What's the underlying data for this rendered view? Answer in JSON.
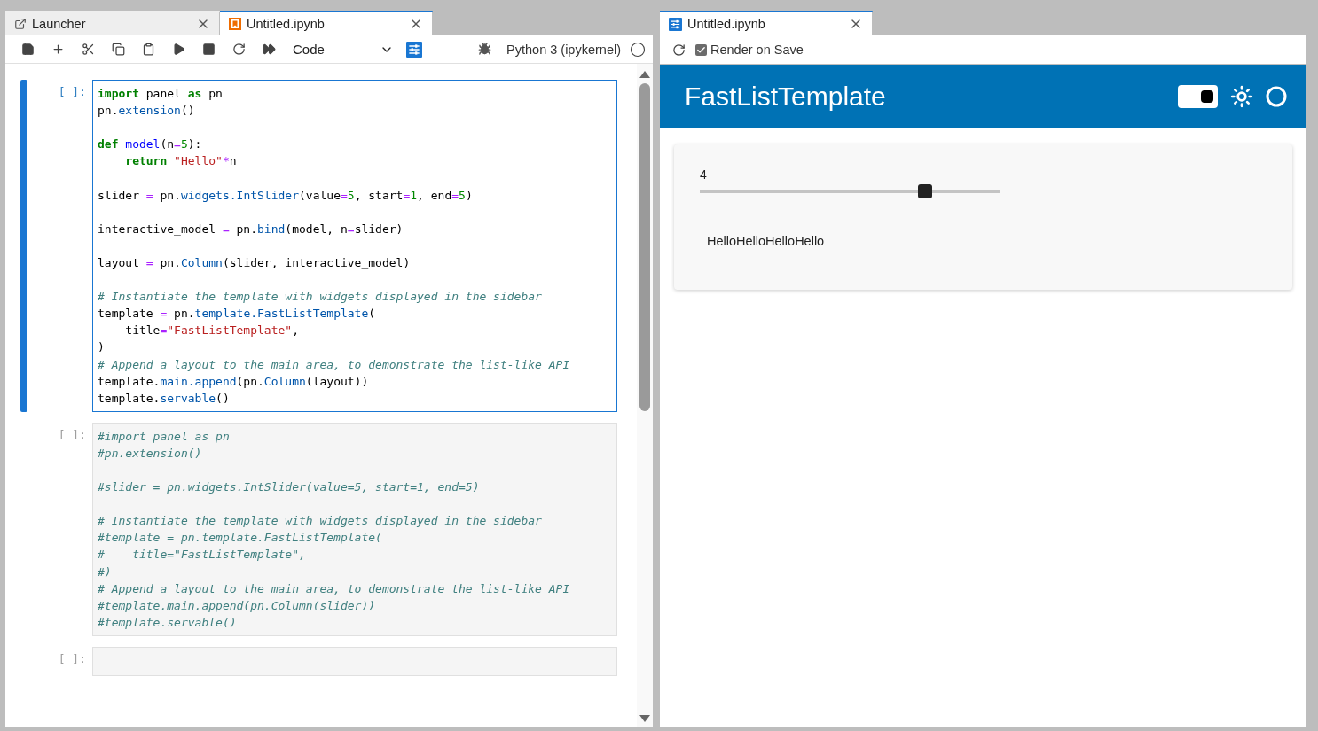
{
  "notebook_panel": {
    "tabs": [
      {
        "kind": "launcher",
        "label": "Launcher",
        "selected": false
      },
      {
        "kind": "notebook",
        "label": "Untitled.ipynb",
        "selected": true
      }
    ],
    "toolbar": {
      "cell_type": "Code",
      "kernel": "Python 3 (ipykernel)"
    },
    "cells": [
      {
        "prompt": "[ ]:",
        "selected": true,
        "lines": [
          {
            "kind": "code",
            "tokens": [
              {
                "kind": "keyword",
                "text": "import"
              },
              {
                "kind": "plain",
                "text": " panel "
              },
              {
                "kind": "keyword",
                "text": "as"
              },
              {
                "kind": "plain",
                "text": " pn"
              }
            ]
          },
          {
            "kind": "code",
            "tokens": [
              {
                "kind": "plain",
                "text": "pn."
              },
              {
                "kind": "property",
                "text": "extension"
              },
              {
                "kind": "plain",
                "text": "()"
              }
            ]
          },
          {
            "kind": "blank"
          },
          {
            "kind": "code",
            "tokens": [
              {
                "kind": "keyword",
                "text": "def"
              },
              {
                "kind": "def",
                "text": " model"
              },
              {
                "kind": "plain",
                "text": "(n"
              },
              {
                "kind": "op",
                "text": "="
              },
              {
                "kind": "number",
                "text": "5"
              },
              {
                "kind": "plain",
                "text": "):"
              }
            ]
          },
          {
            "kind": "code",
            "tokens": [
              {
                "kind": "keyword",
                "text": "    return"
              },
              {
                "kind": "string",
                "text": " \"Hello\""
              },
              {
                "kind": "op",
                "text": "*"
              },
              {
                "kind": "plain",
                "text": "n"
              }
            ]
          },
          {
            "kind": "blank"
          },
          {
            "kind": "code",
            "tokens": [
              {
                "kind": "plain",
                "text": "slider "
              },
              {
                "kind": "op",
                "text": "="
              },
              {
                "kind": "plain",
                "text": " pn."
              },
              {
                "kind": "property",
                "text": "widgets.IntSlider"
              },
              {
                "kind": "plain",
                "text": "(value"
              },
              {
                "kind": "op",
                "text": "="
              },
              {
                "kind": "number",
                "text": "5"
              },
              {
                "kind": "plain",
                "text": ", start"
              },
              {
                "kind": "op",
                "text": "="
              },
              {
                "kind": "number",
                "text": "1"
              },
              {
                "kind": "plain",
                "text": ", end"
              },
              {
                "kind": "op",
                "text": "="
              },
              {
                "kind": "number",
                "text": "5"
              },
              {
                "kind": "plain",
                "text": ")"
              }
            ]
          },
          {
            "kind": "blank"
          },
          {
            "kind": "code",
            "tokens": [
              {
                "kind": "plain",
                "text": "interactive_model "
              },
              {
                "kind": "op",
                "text": "="
              },
              {
                "kind": "plain",
                "text": " pn."
              },
              {
                "kind": "property",
                "text": "bind"
              },
              {
                "kind": "plain",
                "text": "(model, n"
              },
              {
                "kind": "op",
                "text": "="
              },
              {
                "kind": "plain",
                "text": "slider)"
              }
            ]
          },
          {
            "kind": "blank"
          },
          {
            "kind": "code",
            "tokens": [
              {
                "kind": "plain",
                "text": "layout "
              },
              {
                "kind": "op",
                "text": "="
              },
              {
                "kind": "plain",
                "text": " pn."
              },
              {
                "kind": "property",
                "text": "Column"
              },
              {
                "kind": "plain",
                "text": "(slider, interactive_model)"
              }
            ]
          },
          {
            "kind": "blank"
          },
          {
            "kind": "code",
            "tokens": [
              {
                "kind": "comment",
                "text": "# Instantiate the template with widgets displayed in the sidebar"
              }
            ]
          },
          {
            "kind": "code",
            "tokens": [
              {
                "kind": "plain",
                "text": "template "
              },
              {
                "kind": "op",
                "text": "="
              },
              {
                "kind": "plain",
                "text": " pn."
              },
              {
                "kind": "property",
                "text": "template.FastListTemplate"
              },
              {
                "kind": "plain",
                "text": "("
              }
            ]
          },
          {
            "kind": "code",
            "tokens": [
              {
                "kind": "plain",
                "text": "    title"
              },
              {
                "kind": "op",
                "text": "="
              },
              {
                "kind": "string",
                "text": "\"FastListTemplate\""
              },
              {
                "kind": "plain",
                "text": ","
              }
            ]
          },
          {
            "kind": "code",
            "tokens": [
              {
                "kind": "plain",
                "text": ")"
              }
            ]
          },
          {
            "kind": "code",
            "tokens": [
              {
                "kind": "comment",
                "text": "# Append a layout to the main area, to demonstrate the list-like API"
              }
            ]
          },
          {
            "kind": "code",
            "tokens": [
              {
                "kind": "plain",
                "text": "template."
              },
              {
                "kind": "property",
                "text": "main.append"
              },
              {
                "kind": "plain",
                "text": "(pn."
              },
              {
                "kind": "property",
                "text": "Column"
              },
              {
                "kind": "plain",
                "text": "(layout))"
              }
            ]
          },
          {
            "kind": "code",
            "tokens": [
              {
                "kind": "plain",
                "text": "template."
              },
              {
                "kind": "property",
                "text": "servable"
              },
              {
                "kind": "plain",
                "text": "()"
              }
            ]
          }
        ]
      },
      {
        "prompt": "[ ]:",
        "selected": false,
        "lines": [
          {
            "kind": "code",
            "tokens": [
              {
                "kind": "comment",
                "text": "#import panel as pn"
              }
            ]
          },
          {
            "kind": "code",
            "tokens": [
              {
                "kind": "comment",
                "text": "#pn.extension()"
              }
            ]
          },
          {
            "kind": "blank"
          },
          {
            "kind": "code",
            "tokens": [
              {
                "kind": "comment",
                "text": "#slider = pn.widgets.IntSlider(value=5, start=1, end=5)"
              }
            ]
          },
          {
            "kind": "blank"
          },
          {
            "kind": "code",
            "tokens": [
              {
                "kind": "comment",
                "text": "# Instantiate the template with widgets displayed in the sidebar"
              }
            ]
          },
          {
            "kind": "code",
            "tokens": [
              {
                "kind": "comment",
                "text": "#template = pn.template.FastListTemplate("
              }
            ]
          },
          {
            "kind": "code",
            "tokens": [
              {
                "kind": "comment",
                "text": "#    title=\"FastListTemplate\","
              }
            ]
          },
          {
            "kind": "code",
            "tokens": [
              {
                "kind": "comment",
                "text": "#)"
              }
            ]
          },
          {
            "kind": "code",
            "tokens": [
              {
                "kind": "comment",
                "text": "# Append a layout to the main area, to demonstrate the list-like API"
              }
            ]
          },
          {
            "kind": "code",
            "tokens": [
              {
                "kind": "comment",
                "text": "#template.main.append(pn.Column(slider))"
              }
            ]
          },
          {
            "kind": "code",
            "tokens": [
              {
                "kind": "comment",
                "text": "#template.servable()"
              }
            ]
          }
        ]
      },
      {
        "prompt": "[ ]:",
        "selected": false
      }
    ]
  },
  "preview_panel": {
    "tab": {
      "label": "Untitled.ipynb",
      "selected": true
    },
    "render_on_save": {
      "label": "Render on Save",
      "checked": true
    },
    "header": {
      "title": "FastListTemplate",
      "theme_toggle": {
        "on": true
      }
    },
    "slider": {
      "value_label": "4",
      "level": 0.75
    },
    "output": "HelloHelloHelloHello"
  }
}
